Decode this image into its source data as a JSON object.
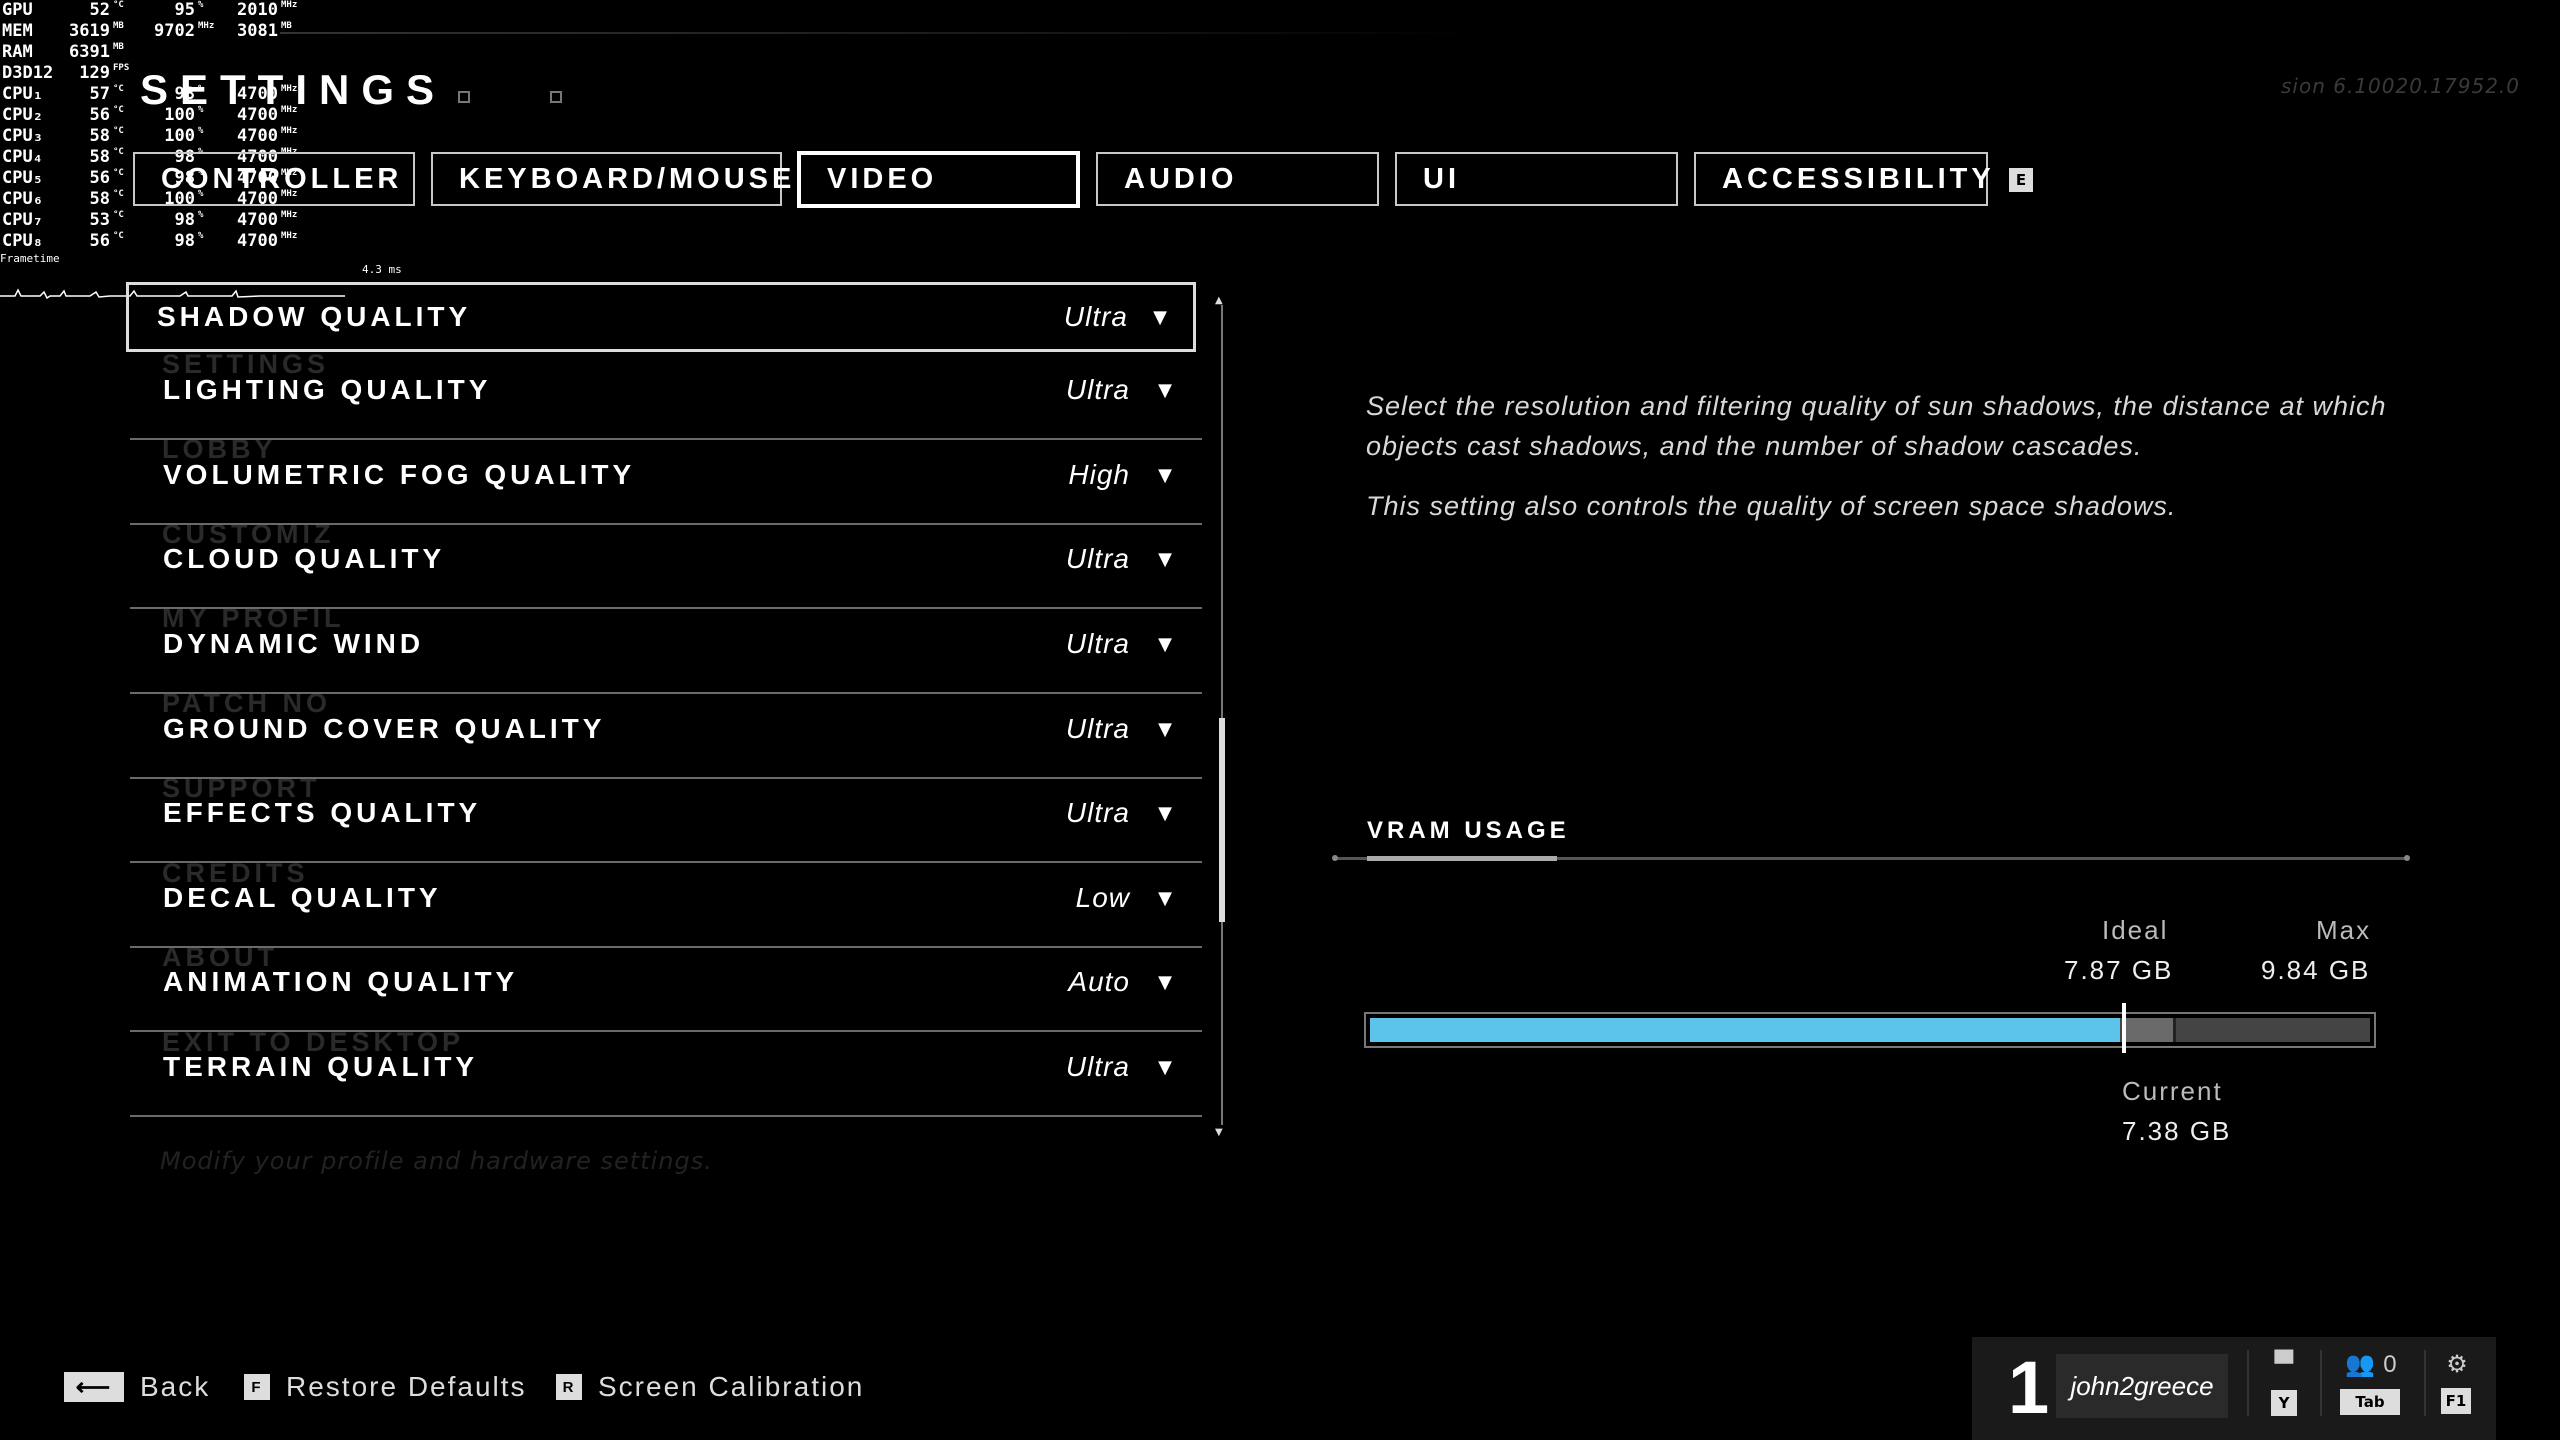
{
  "osd": {
    "rows": [
      {
        "label": "GPU",
        "v1": "52",
        "u1": "°C",
        "v2": "95",
        "u2": "%",
        "v3": "2010",
        "u3": "MHz"
      },
      {
        "label": "MEM",
        "v1": "3619",
        "u1": "MB",
        "v2": "9702",
        "u2": "MHz",
        "v3": "3081",
        "u3": "MB"
      },
      {
        "label": "RAM",
        "v1": "6391",
        "u1": "MB",
        "v2": "",
        "u2": "",
        "v3": "",
        "u3": ""
      },
      {
        "label": "D3D12",
        "v1": "129",
        "u1": "FPS",
        "v2": "",
        "u2": "",
        "v3": "",
        "u3": ""
      },
      {
        "label": "CPU₁",
        "v1": "57",
        "u1": "°C",
        "v2": "98",
        "u2": "%",
        "v3": "4700",
        "u3": "MHz"
      },
      {
        "label": "CPU₂",
        "v1": "56",
        "u1": "°C",
        "v2": "100",
        "u2": "%",
        "v3": "4700",
        "u3": "MHz"
      },
      {
        "label": "CPU₃",
        "v1": "58",
        "u1": "°C",
        "v2": "100",
        "u2": "%",
        "v3": "4700",
        "u3": "MHz"
      },
      {
        "label": "CPU₄",
        "v1": "58",
        "u1": "°C",
        "v2": "98",
        "u2": "%",
        "v3": "4700",
        "u3": "MHz"
      },
      {
        "label": "CPU₅",
        "v1": "56",
        "u1": "°C",
        "v2": "98",
        "u2": "%",
        "v3": "4700",
        "u3": "MHz"
      },
      {
        "label": "CPU₆",
        "v1": "58",
        "u1": "°C",
        "v2": "100",
        "u2": "%",
        "v3": "4700",
        "u3": "MHz"
      },
      {
        "label": "CPU₇",
        "v1": "53",
        "u1": "°C",
        "v2": "98",
        "u2": "%",
        "v3": "4700",
        "u3": "MHz"
      },
      {
        "label": "CPU₈",
        "v1": "56",
        "u1": "°C",
        "v2": "98",
        "u2": "%",
        "v3": "4700",
        "u3": "MHz"
      }
    ],
    "frametime_label": "Frametime",
    "frametime_ms": "4.3 ms"
  },
  "header": {
    "title": "SETTINGS",
    "version": "sion 6.10020.17952.0"
  },
  "tabs": [
    {
      "label": "CONTROLLER"
    },
    {
      "label": "KEYBOARD/MOUSE"
    },
    {
      "label": "VIDEO"
    },
    {
      "label": "AUDIO"
    },
    {
      "label": "UI"
    },
    {
      "label": "ACCESSIBILITY"
    }
  ],
  "tabs_next_key": "E",
  "ghost_menu": [
    "SETTINGS",
    "LOBBY",
    "CUSTOMIZ",
    "MY PROFIL",
    "PATCH NO",
    "SUPPORT",
    "CREDITS",
    "ABOUT",
    "EXIT TO DESKTOP"
  ],
  "ghost_hint": "Modify your profile and hardware settings.",
  "settings": [
    {
      "name": "SHADOW QUALITY",
      "value": "Ultra"
    },
    {
      "name": "LIGHTING QUALITY",
      "value": "Ultra"
    },
    {
      "name": "VOLUMETRIC FOG QUALITY",
      "value": "High"
    },
    {
      "name": "CLOUD QUALITY",
      "value": "Ultra"
    },
    {
      "name": "DYNAMIC WIND",
      "value": "Ultra"
    },
    {
      "name": "GROUND COVER QUALITY",
      "value": "Ultra"
    },
    {
      "name": "EFFECTS QUALITY",
      "value": "Ultra"
    },
    {
      "name": "DECAL QUALITY",
      "value": "Low"
    },
    {
      "name": "ANIMATION QUALITY",
      "value": "Auto"
    },
    {
      "name": "TERRAIN QUALITY",
      "value": "Ultra"
    }
  ],
  "description": {
    "p1": "Select the resolution and filtering quality of sun shadows, the distance at which objects cast shadows, and the number of shadow cascades.",
    "p2": "This setting also controls the quality of screen space shadows."
  },
  "vram": {
    "title": "VRAM USAGE",
    "ideal_label": "Ideal",
    "ideal_value": "7.87 GB",
    "max_label": "Max",
    "max_value": "9.84 GB",
    "current_label": "Current",
    "current_value": "7.38 GB",
    "current_fraction": 0.75,
    "ideal_fraction": 0.8,
    "bar_color": "#5cc3eb"
  },
  "footer": {
    "back_label": "Back",
    "restore_key": "F",
    "restore_label": "Restore Defaults",
    "calib_key": "R",
    "calib_label": "Screen Calibration"
  },
  "player": {
    "number": "1",
    "gamertag": "john2greece",
    "chat_key": "Y",
    "party_count": "0",
    "party_key": "Tab",
    "settings_key": "F1"
  }
}
